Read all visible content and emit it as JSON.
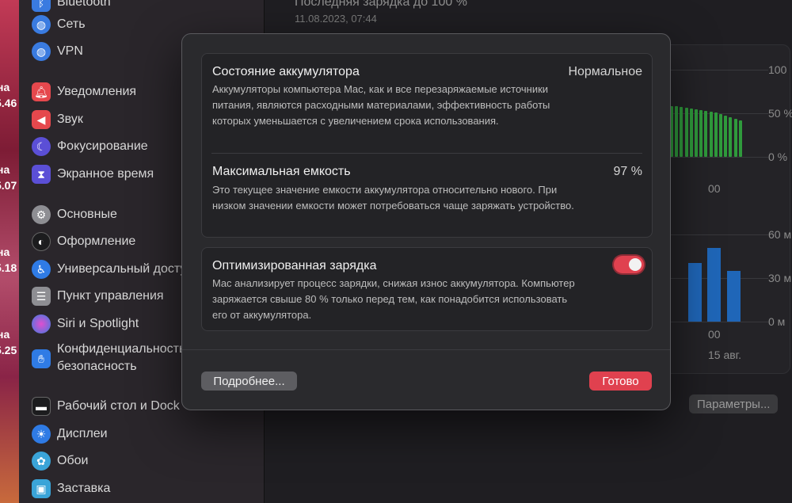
{
  "desktop": {
    "labels": [
      "на",
      "5.46",
      "на",
      "5.07",
      "на",
      "5.18",
      "на",
      "5.25"
    ]
  },
  "sidebar": {
    "items": [
      {
        "label": "Bluetooth",
        "icon": "bluetooth-icon",
        "color": "#3a7be0"
      },
      {
        "label": "Сеть",
        "icon": "globe-icon",
        "color": "#3a7be0"
      },
      {
        "label": "VPN",
        "icon": "globe-icon",
        "color": "#3a7be0"
      },
      {
        "label": "Уведомления",
        "icon": "bell-icon",
        "color": "#e5484d"
      },
      {
        "label": "Звук",
        "icon": "speaker-icon",
        "color": "#e5484d"
      },
      {
        "label": "Фокусирование",
        "icon": "moon-icon",
        "color": "#5b4fd6"
      },
      {
        "label": "Экранное время",
        "icon": "hourglass-icon",
        "color": "#5b4fd6"
      },
      {
        "label": "Основные",
        "icon": "gear-icon",
        "color": "#8e8e93"
      },
      {
        "label": "Оформление",
        "icon": "appearance-icon",
        "color": "#1c1c1e"
      },
      {
        "label": "Универсальный доступ",
        "icon": "accessibility-icon",
        "color": "#2f7be5"
      },
      {
        "label": "Пункт управления",
        "icon": "control-center-icon",
        "color": "#8e8e93"
      },
      {
        "label": "Siri и Spotlight",
        "icon": "siri-icon",
        "color": "#c04fd0"
      },
      {
        "label_line1": "Конфиденциальность и",
        "label_line2": "безопасность",
        "icon": "hand-icon",
        "color": "#2f7be5"
      },
      {
        "label": "Рабочий стол и Dock",
        "icon": "dock-icon",
        "color": "#1c1c1e"
      },
      {
        "label": "Дисплеи",
        "icon": "sun-icon",
        "color": "#2f7be5"
      },
      {
        "label": "Обои",
        "icon": "flower-icon",
        "color": "#3aa4d8"
      },
      {
        "label": "Заставка",
        "icon": "screensaver-icon",
        "color": "#3aa4d8"
      }
    ]
  },
  "main": {
    "last_charge_title": "Последняя зарядка до 100 %",
    "last_charge_date": "11.08.2023, 07:44",
    "chart_top": {
      "ticks": [
        "100",
        "50 %",
        "0 %"
      ],
      "x_label": "00",
      "bar_color": "#2f9a3c"
    },
    "chart_bottom": {
      "ticks": [
        "60 м",
        "30 м",
        "0 м"
      ],
      "x_label": "00",
      "date_label": "15 авг.",
      "bar_color": "#1f66b8"
    },
    "params_button": "Параметры..."
  },
  "modal": {
    "battery_state": {
      "title": "Состояние аккумулятора",
      "value": "Нормальное",
      "description": "Аккумуляторы компьютера Mac, как и все перезаряжаемые источники питания, являются расходными материалами, эффективность работы которых уменьшается с увеличением срока использования."
    },
    "max_capacity": {
      "title": "Максимальная емкость",
      "value": "97 %",
      "description": "Это текущее значение емкости аккумулятора относительно нового. При низком значении емкости может потребоваться чаще заряжать устройство."
    },
    "optimized_charging": {
      "title": "Оптимизированная зарядка",
      "enabled": true,
      "description": "Mac анализирует процесс зарядки, снижая износ аккумулятора. Компьютер заряжается свыше 80 % только перед тем, как понадобится использовать его от аккумулятора."
    },
    "more_button": "Подробнее...",
    "done_button": "Готово",
    "accent_color": "#e0414f"
  }
}
